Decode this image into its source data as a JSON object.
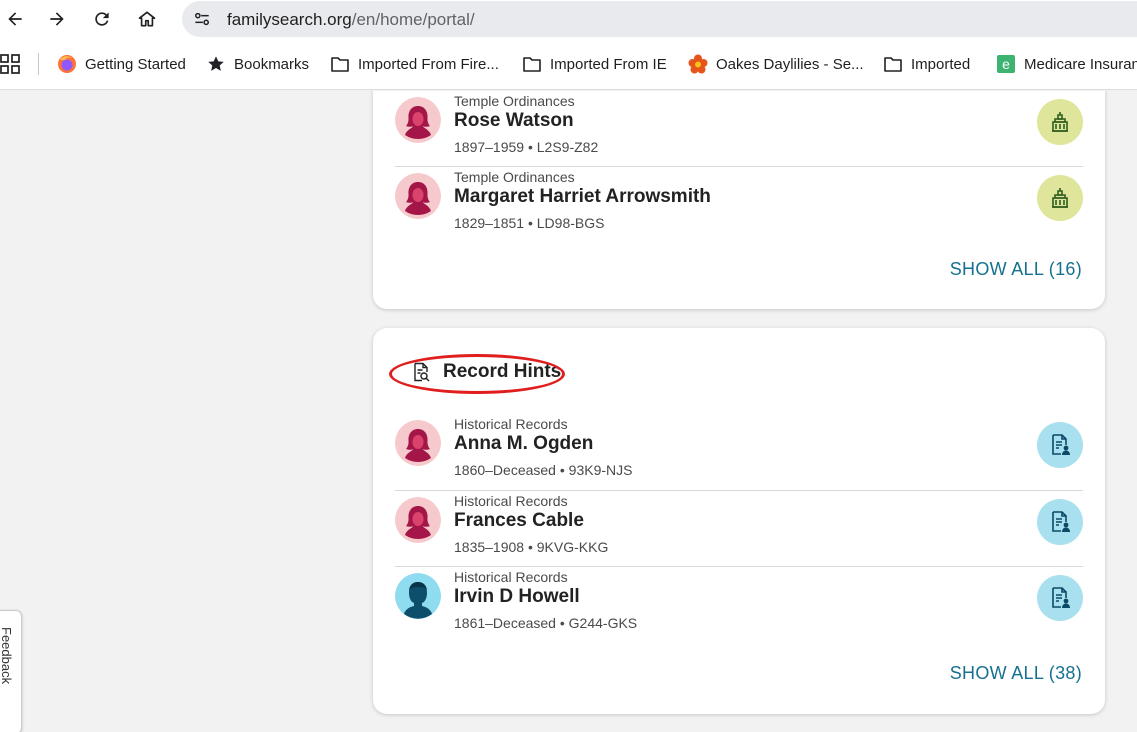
{
  "browser": {
    "url_domain": "familysearch.org",
    "url_path": "/en/home/portal/",
    "bookmarks": [
      {
        "label": "Getting Started",
        "icon": "firefox-icon"
      },
      {
        "label": "Bookmarks",
        "icon": "star-icon"
      },
      {
        "label": "Imported From Fire...",
        "icon": "folder-icon"
      },
      {
        "label": "Imported From IE",
        "icon": "folder-icon"
      },
      {
        "label": "Oakes Daylilies - Se...",
        "icon": "flower-icon"
      },
      {
        "label": "Imported",
        "icon": "folder-icon"
      },
      {
        "label": "Medicare Insuran",
        "icon": "medicare-e-icon"
      }
    ]
  },
  "temple": {
    "rows": [
      {
        "subtitle": "Temple Ordinances",
        "name": "Rose Watson",
        "meta": "1897–1959 • L2S9-Z82",
        "gender": "female"
      },
      {
        "subtitle": "Temple Ordinances",
        "name": "Margaret Harriet Arrowsmith",
        "meta": "1829–1851 • LD98-BGS",
        "gender": "female"
      }
    ],
    "show_all": "SHOW ALL (16)"
  },
  "hints": {
    "title": "Record Hints",
    "rows": [
      {
        "subtitle": "Historical Records",
        "name": "Anna M. Ogden",
        "meta": "1860–Deceased • 93K9-NJS",
        "gender": "female"
      },
      {
        "subtitle": "Historical Records",
        "name": "Frances Cable",
        "meta": "1835–1908 • 9KVG-KKG",
        "gender": "female"
      },
      {
        "subtitle": "Historical Records",
        "name": "Irvin D Howell",
        "meta": "1861–Deceased • G244-GKS",
        "gender": "male"
      }
    ],
    "show_all": "SHOW ALL (38)"
  },
  "feedback": {
    "label": "Feedback"
  },
  "colors": {
    "accent": "#15718f",
    "temple_badge": "#dfe59a",
    "record_badge": "#a8e0f0",
    "female_avatar": "#f6c9cd",
    "male_avatar": "#8fdcf1",
    "annotation": "#e01e1e"
  }
}
